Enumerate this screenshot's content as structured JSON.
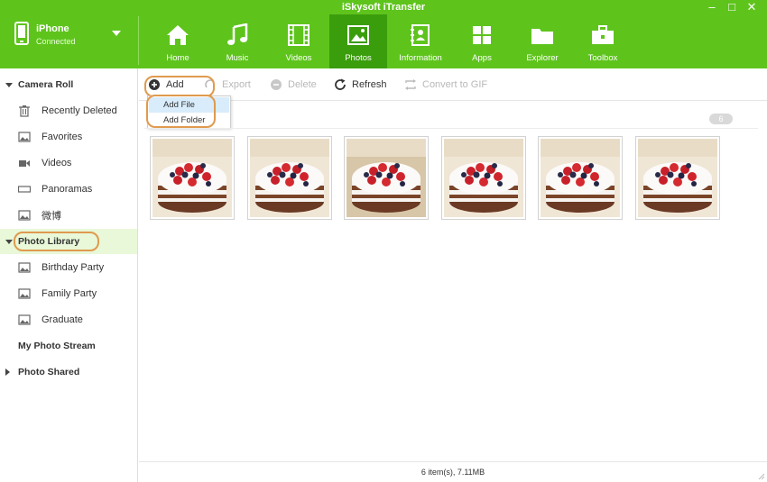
{
  "app": {
    "title": "iSkysoft iTransfer"
  },
  "window_controls": {
    "minimize": "–",
    "maximize": "□",
    "close": "✕"
  },
  "device": {
    "name": "iPhone",
    "status": "Connected",
    "icon": "phone-icon"
  },
  "nav": {
    "items": [
      {
        "label": "Home",
        "icon": "house-icon",
        "active": false
      },
      {
        "label": "Music",
        "icon": "music-note-icon",
        "active": false
      },
      {
        "label": "Videos",
        "icon": "film-icon",
        "active": false
      },
      {
        "label": "Photos",
        "icon": "picture-icon",
        "active": true
      },
      {
        "label": "Information",
        "icon": "contacts-book-icon",
        "active": false
      },
      {
        "label": "Apps",
        "icon": "apps-grid-icon",
        "active": false
      },
      {
        "label": "Explorer",
        "icon": "folder-icon",
        "active": false
      },
      {
        "label": "Toolbox",
        "icon": "toolbox-icon",
        "active": false
      }
    ]
  },
  "sidebar": {
    "camera_roll": {
      "label": "Camera Roll",
      "children": [
        {
          "label": "Recently Deleted",
          "icon": "trash-icon"
        },
        {
          "label": "Favorites",
          "icon": "image-icon"
        },
        {
          "label": "Videos",
          "icon": "video-camera-icon"
        },
        {
          "label": "Panoramas",
          "icon": "panorama-icon"
        },
        {
          "label": "微博",
          "icon": "image-icon"
        }
      ]
    },
    "photo_library": {
      "label": "Photo Library",
      "children": [
        {
          "label": "Birthday Party",
          "icon": "image-icon"
        },
        {
          "label": "Family Party",
          "icon": "image-icon"
        },
        {
          "label": "Graduate",
          "icon": "image-icon"
        }
      ]
    },
    "my_photo_stream": {
      "label": "My Photo Stream"
    },
    "photo_shared": {
      "label": "Photo Shared"
    }
  },
  "toolbar": {
    "add": "Add",
    "export": "Export",
    "delete": "Delete",
    "refresh": "Refresh",
    "convert_gif": "Convert to GIF"
  },
  "add_menu": {
    "add_file": "Add File",
    "add_folder": "Add Folder"
  },
  "content": {
    "count": "6"
  },
  "status": {
    "text": "6 item(s), 7.11MB"
  },
  "colors": {
    "header_green": "#5ec41c",
    "active_tab": "#3a9d0c",
    "highlight_orange": "#e09a4e",
    "selected_row": "#e8f8d8"
  }
}
